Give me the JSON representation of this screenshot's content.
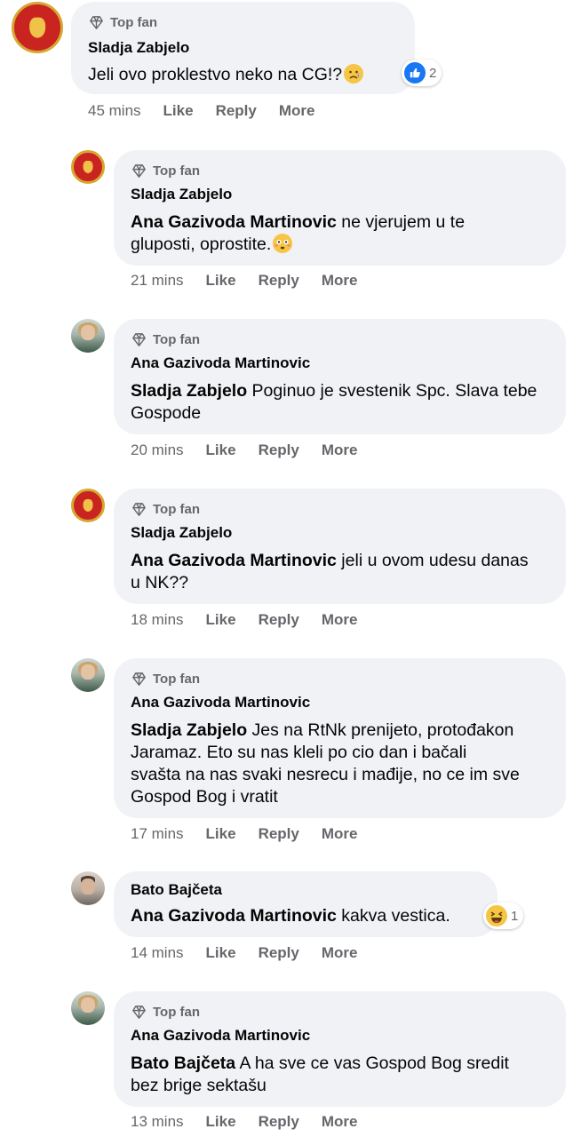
{
  "badge_label": "Top fan",
  "actions": {
    "like": "Like",
    "reply": "Reply",
    "more": "More"
  },
  "comments": [
    {
      "author": "Sladja Zabjelo",
      "top_fan": true,
      "mention": "",
      "text": "Jeli ovo proklestvo neko na CG!?",
      "emoji": "sad-emoji",
      "reaction": {
        "type": "like",
        "count": "2"
      },
      "time": "45 mins"
    },
    {
      "author": "Sladja Zabjelo",
      "top_fan": true,
      "mention": "Ana Gazivoda Martinovic",
      "text": " ne vjerujem u te gluposti, oprostite.",
      "emoji": "flushed-emoji",
      "time": "21 mins"
    },
    {
      "author": "Ana Gazivoda Martinovic",
      "top_fan": true,
      "mention": "Sladja Zabjelo",
      "text": " Poginuo je svestenik Spc. Slava tebe Gospode",
      "time": "20 mins"
    },
    {
      "author": "Sladja Zabjelo",
      "top_fan": true,
      "mention": "Ana Gazivoda Martinovic",
      "text": " jeli u ovom udesu danas u NK??",
      "time": "18 mins"
    },
    {
      "author": "Ana Gazivoda Martinovic",
      "top_fan": true,
      "mention": "Sladja Zabjelo",
      "text": " Jes na RtNk prenijeto, protođakon Jaramaz. Eto su nas kleli po cio dan i bačali svašta na nas svaki nesrecu i mađije, no ce im sve Gospod Bog i vratit",
      "time": "17 mins"
    },
    {
      "author": "Bato Bajčeta",
      "top_fan": false,
      "mention": "Ana Gazivoda Martinovic",
      "text": " kakva vestica.",
      "reaction": {
        "type": "haha",
        "count": "1"
      },
      "time": "14 mins"
    },
    {
      "author": "Ana Gazivoda Martinovic",
      "top_fan": true,
      "mention": "Bato Bajčeta",
      "text": " A ha sve ce vas Gospod Bog sredit bez brige sektašu",
      "time": "13 mins"
    }
  ]
}
